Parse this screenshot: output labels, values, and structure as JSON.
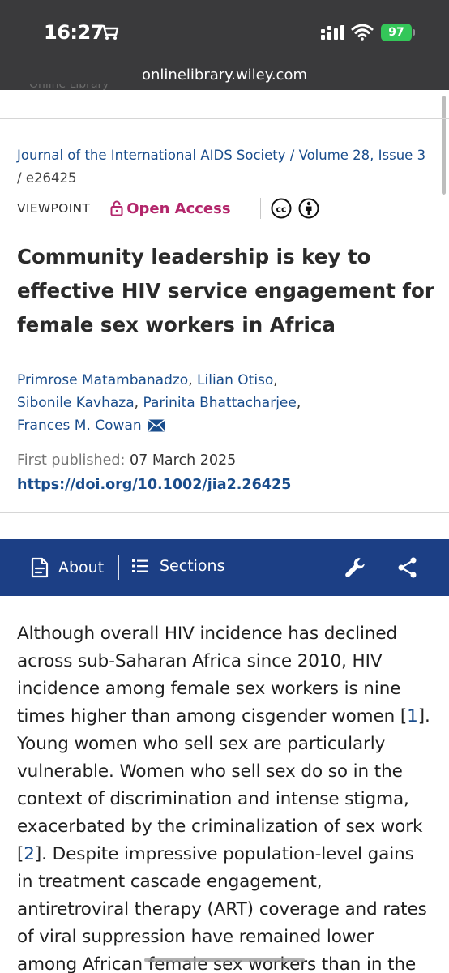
{
  "status_bar": {
    "time": "16:27",
    "battery": "97"
  },
  "browser": {
    "url": "onlinelibrary.wiley.com"
  },
  "header": {
    "logo_text_cut": "Online Library"
  },
  "article": {
    "journal": "Journal of the International AIDS Society / Volume 28, Issue 3",
    "separator": "/",
    "article_number": "e26425",
    "type": "VIEWPOINT",
    "access": "Open Access",
    "title": "Community leadership is key to effective HIV service engagement for female sex workers in Africa",
    "authors": [
      "Primrose Matambanadzo",
      "Lilian Otiso",
      "Sibonile Kavhaza",
      "Parinita Bhattacharjee",
      "Frances M. Cowan"
    ],
    "first_published_label": "First published:",
    "first_published_date": "07 March 2025",
    "doi": "https://doi.org/10.1002/jia2.26425"
  },
  "toolbar": {
    "about_label": "About",
    "sections_label": "Sections"
  },
  "body": {
    "p1_a": "Although overall HIV incidence has declined across sub-Saharan Africa since 2010, HIV incidence among female sex workers is nine times higher than among cisgender women [",
    "ref1": "1",
    "p1_b": "]. Young women who sell sex are particularly vulnerable. Women who sell sex do so in the context of discrimination and intense stigma, exacerbated by the criminalization of sex work [",
    "ref2": "2",
    "p1_c": "]. Despite impressive population-level gains in treatment cascade engagement, antiretroviral therapy (ART) coverage and rates of viral suppression have remained lower among African female sex workers than in the general"
  },
  "colors": {
    "link": "#1a4d8c",
    "open_access": "#b3266b",
    "navbar": "#1c3f85",
    "status_bar": "#3a3a3c"
  }
}
